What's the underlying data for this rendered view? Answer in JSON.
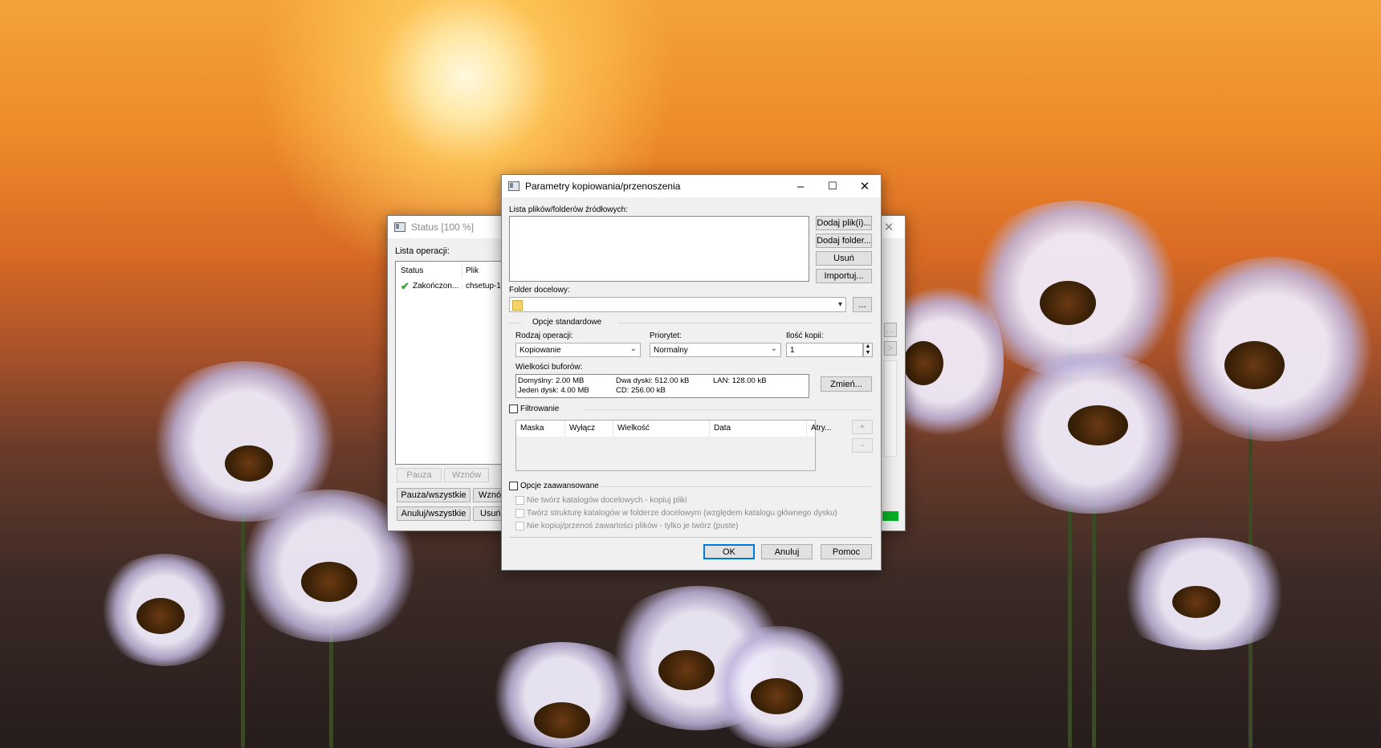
{
  "status_window": {
    "title": "Status [100 %]",
    "ops_label": "Lista operacji:",
    "columns": [
      "Status",
      "Plik"
    ],
    "row": {
      "status": "Zakończon...",
      "file": "chsetup-1"
    },
    "buttons": {
      "pause": "Pauza",
      "resume": "Wznów",
      "pause_all": "Pauza/wszystkie",
      "resume2": "Wznó",
      "cancel_all": "Anuluj/wszystkie",
      "remove": "Usuń"
    }
  },
  "dialog": {
    "title": "Parametry kopiowania/przenoszenia",
    "source_label": "Lista plików/folderów źródłowych:",
    "side_buttons": [
      "Dodaj plik(i)...",
      "Dodaj folder...",
      "Usuń",
      "Importuj..."
    ],
    "dest_label": "Folder docelowy:",
    "browse_label": "...",
    "std_options_label": "Opcje standardowe",
    "op_type_label": "Rodzaj operacji:",
    "op_type_value": "Kopiowanie",
    "priority_label": "Priorytet:",
    "priority_value": "Normalny",
    "copies_label": "Ilość kopii:",
    "copies_value": "1",
    "buffers_label": "Wielkości buforów:",
    "buffers": {
      "default": "Domyślny: 2.00 MB",
      "one_disk": "Jeden dysk: 4.00 MB",
      "two_disks": "Dwa dyski: 512.00 kB",
      "cd": "CD: 256.00 kB",
      "lan": "LAN: 128.00 kB"
    },
    "change_label": "Zmień...",
    "filter_label": "Filtrowanie",
    "filter_columns": [
      "Maska",
      "Wyłącz",
      "Wielkość",
      "Data",
      "Atry..."
    ],
    "plus_label": "+",
    "minus_label": "-",
    "advanced_label": "Opcje zaawansowane",
    "advanced_opts": [
      "Nie twórz katalogów docelowych - kopiuj pliki",
      "Twórz strukturę katalogów w folderze docelowym (względem katalogu głównego dysku)",
      "Nie kopiuj/przenoś zawartości plików - tylko je twórz (puste)"
    ],
    "ok_label": "OK",
    "cancel_label": "Anuluj",
    "help_label": "Pomoc"
  },
  "colors": {
    "accent": "#0078d7",
    "check": "#2fa82f",
    "progress": "#06b025"
  }
}
